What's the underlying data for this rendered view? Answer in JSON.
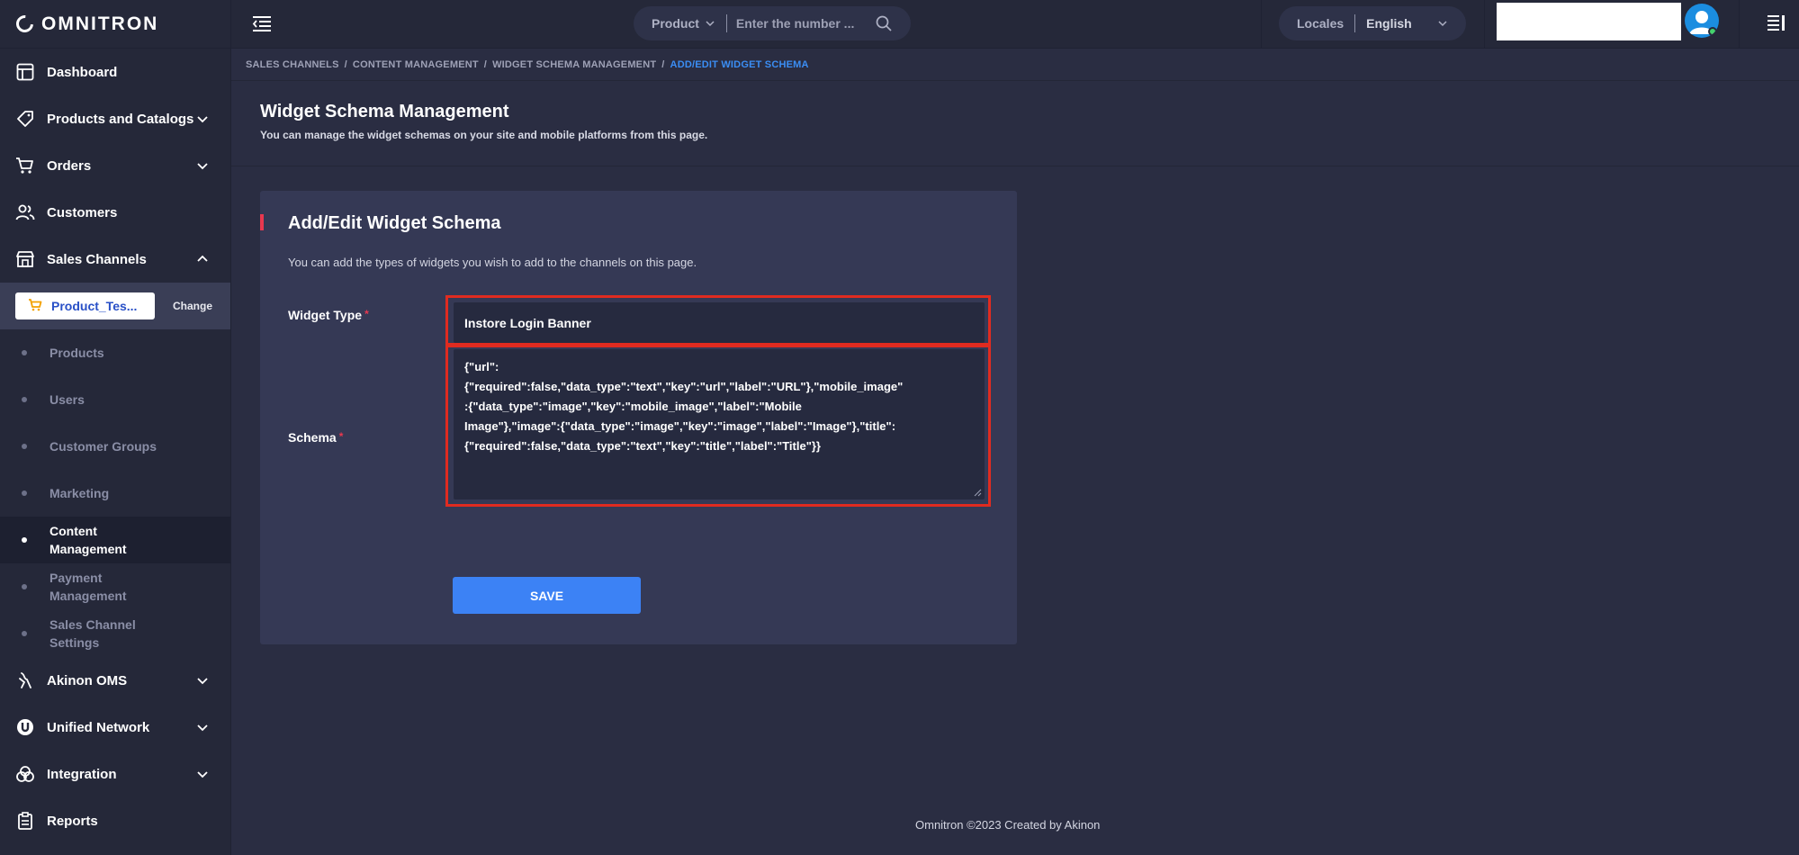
{
  "app": {
    "brand": "OMNITRON"
  },
  "sidebar": {
    "items": [
      {
        "label": "Dashboard",
        "icon": "dashboard-icon",
        "expand": ""
      },
      {
        "label": "Products and Catalogs",
        "icon": "tag-icon",
        "expand": "down"
      },
      {
        "label": "Orders",
        "icon": "cart-icon",
        "expand": "down"
      },
      {
        "label": "Customers",
        "icon": "users-icon",
        "expand": ""
      },
      {
        "label": "Sales Channels",
        "icon": "store-icon",
        "expand": "up"
      }
    ],
    "channel": {
      "name": "Product_Tes...",
      "change_label": "Change"
    },
    "sub_items": [
      {
        "label": "Products"
      },
      {
        "label": "Users"
      },
      {
        "label": "Customer Groups"
      },
      {
        "label": "Marketing"
      },
      {
        "label": "Content Management",
        "active": true
      },
      {
        "label": "Payment Management"
      },
      {
        "label": "Sales Channel Settings"
      }
    ],
    "bottom_items": [
      {
        "label": "Akinon OMS",
        "icon": "oms-icon",
        "expand": "down"
      },
      {
        "label": "Unified Network",
        "icon": "network-icon",
        "expand": "down"
      },
      {
        "label": "Integration",
        "icon": "integration-icon",
        "expand": "down"
      },
      {
        "label": "Reports",
        "icon": "reports-icon",
        "expand": ""
      }
    ]
  },
  "topbar": {
    "search": {
      "category": "Product",
      "placeholder": "Enter the number ..."
    },
    "locale": {
      "label": "Locales",
      "value": "English"
    }
  },
  "breadcrumb": {
    "items": [
      "SALES CHANNELS",
      "CONTENT MANAGEMENT",
      "WIDGET SCHEMA MANAGEMENT"
    ],
    "current": "ADD/EDIT WIDGET SCHEMA"
  },
  "page": {
    "title": "Widget Schema Management",
    "subtitle": "You can manage the widget schemas on your site and mobile platforms from this page."
  },
  "form": {
    "title": "Add/Edit Widget Schema",
    "description": "You can add the types of widgets you wish to add to the channels on this page.",
    "widget_type_label": "Widget Type",
    "widget_type_value": "Instore Login Banner",
    "schema_label": "Schema",
    "required_mark": "*",
    "schema_value": "{\"url\":{\"required\":false,\"data_type\":\"text\",\"key\":\"url\",\"label\":\"URL\"},\"mobile_image\":{\"data_type\":\"image\",\"key\":\"mobile_image\",\"label\":\"Mobile Image\"},\"image\":{\"data_type\":\"image\",\"key\":\"image\",\"label\":\"Image\"},\"title\":{\"required\":false,\"data_type\":\"text\",\"key\":\"title\",\"label\":\"Title\"}}",
    "schema_lines": [
      "{\"url\":",
      "{\"required\":false,\"data_type\":\"text\",\"key\":\"url\",\"label\":\"URL\"},\"mobile_image\"",
      ":{\"data_type\":\"image\",\"key\":\"mobile_image\",\"label\":\"Mobile",
      "Image\"},\"image\":{\"data_type\":\"image\",\"key\":\"image\",\"label\":\"Image\"},\"title\":",
      "{\"required\":false,\"data_type\":\"text\",\"key\":\"title\",\"label\":\"Title\"}}"
    ],
    "save_label": "SAVE"
  },
  "footer": {
    "text": "Omnitron ©2023 Created by Akinon"
  },
  "colors": {
    "accent": "#3c82f5",
    "required": "#e8384f",
    "highlight": "#e02b20",
    "breadcrumb_current": "#3b8ef5"
  }
}
